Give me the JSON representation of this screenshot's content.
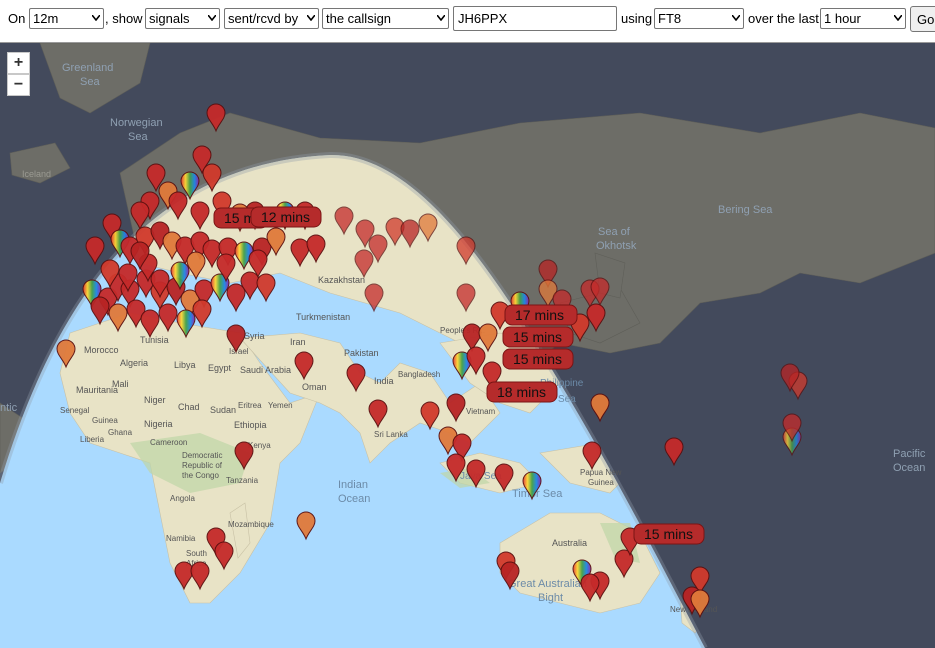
{
  "toolbar": {
    "on_label": "On",
    "band": "12m",
    "show_label": ", show",
    "show_value": "signals",
    "direction": "sent/rcvd by",
    "target_type": "the callsign",
    "callsign": "JH6PPX",
    "using_label": "using",
    "mode": "FT8",
    "over_label": "over the last",
    "period": "1 hour",
    "go_label": "Go"
  },
  "map": {
    "zoom_in": "+",
    "zoom_out": "−",
    "labels": {
      "greenland_sea": [
        "Greenland",
        "Sea"
      ],
      "norwegian_sea": [
        "Norwegian",
        "Sea"
      ],
      "iceland": "Iceland",
      "kazakhstan": "Kazakhstan",
      "turkmenistan": "Turkmenistan",
      "morocco": "Morocco",
      "tunisia": "Tunisia",
      "algeria": "Algeria",
      "libya": "Libya",
      "egypt": "Egypt",
      "syria": "Syria",
      "israel": "Israel",
      "iran": "Iran",
      "saudi_arabia": "Saudi Arabia",
      "oman": "Oman",
      "pakistan": "Pakistan",
      "india": "India",
      "mauritania": "Mauritania",
      "mali": "Mali",
      "niger": "Niger",
      "chad": "Chad",
      "sudan": "Sudan",
      "eritrea": "Eritrea",
      "yemen": "Yemen",
      "senegal": "Senegal",
      "nigeria": "Nigeria",
      "ethiopia": "Ethiopia",
      "guinea": "Guinea",
      "liberia": "Liberia",
      "ghana": "Ghana",
      "cameroon": "Cameroon",
      "kenya": "Kenya",
      "tanzania": "Tanzania",
      "angola": "Angola",
      "namibia": "Namibia",
      "south_africa": [
        "South",
        "Africa"
      ],
      "drc": [
        "Democratic",
        "Republic of",
        "the Congo"
      ],
      "mozambique": "Mozambique",
      "indian_ocean": [
        "Indian",
        "Ocean"
      ],
      "peoples_republic": "People's R...",
      "bangladesh": "Bangladesh",
      "sri_lanka": "Sri Lanka",
      "vietnam": "Vietnam",
      "philippines": "Philippine",
      "sea_right": "Sea",
      "java_sea": "Java Sea",
      "timor_sea": "Timor Sea",
      "papua": [
        "Papua New",
        "Guinea"
      ],
      "australia": "Australia",
      "great_australian_bight": [
        "Great Australian",
        "Bight"
      ],
      "new_zealand": "New Zealand",
      "sea_of_okhotsk": [
        "Sea of",
        "Okhotsk"
      ],
      "bering_sea": "Bering Sea",
      "pacific_ocean": [
        "Pacific",
        "Ocean"
      ],
      "atlantic": "ntic"
    },
    "time_labels": [
      {
        "text": "15 m"
      },
      {
        "text": "12 mins"
      },
      {
        "text": "17 mins"
      },
      {
        "text": "15 mins"
      },
      {
        "text": "15 mins"
      },
      {
        "text": "18 mins"
      },
      {
        "text": "15 mins"
      }
    ]
  },
  "colors": {
    "ocean": "#aadaff",
    "night_ocean": "#434a5c",
    "land": "#e7e2c8",
    "night_land": "#6e6e68",
    "marker_red": "#c52a2a",
    "label_fill": "#b52b2b"
  }
}
